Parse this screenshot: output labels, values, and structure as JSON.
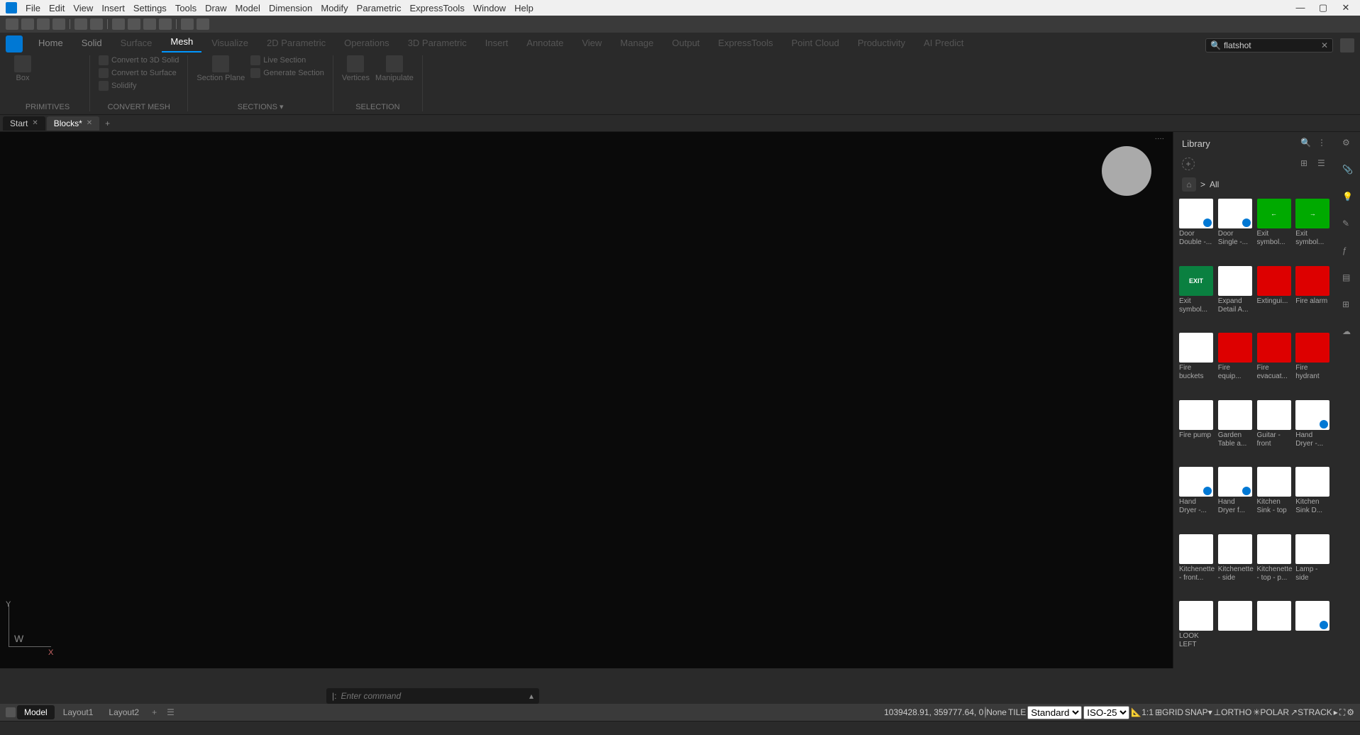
{
  "menubar": {
    "items": [
      "File",
      "Edit",
      "View",
      "Insert",
      "Settings",
      "Tools",
      "Draw",
      "Model",
      "Dimension",
      "Modify",
      "Parametric",
      "ExpressTools",
      "Window",
      "Help"
    ]
  },
  "ribbonTabs": {
    "items": [
      "Home",
      "Solid",
      "Surface",
      "Mesh",
      "Visualize",
      "2D Parametric",
      "Operations",
      "3D Parametric",
      "Insert",
      "Annotate",
      "View",
      "Manage",
      "Output",
      "ExpressTools",
      "Point Cloud",
      "Productivity",
      "AI Predict"
    ],
    "activeIndex": 3,
    "searchValue": "flatshot"
  },
  "ribbon": {
    "groups": [
      {
        "label": "PRIMITIVES",
        "tools": [
          "Box"
        ]
      },
      {
        "label": "CONVERT MESH",
        "list": [
          "Convert to 3D Solid",
          "Convert to Surface",
          "Solidify"
        ]
      },
      {
        "label": "SECTIONS",
        "tools": [
          "Section Plane"
        ],
        "list": [
          "Live Section",
          "Generate Section"
        ]
      },
      {
        "label": "SELECTION",
        "tools": [
          "Vertices",
          "Manipulate"
        ]
      }
    ]
  },
  "docTabs": {
    "items": [
      "Start",
      "Blocks*"
    ],
    "activeIndex": 1
  },
  "library": {
    "title": "Library",
    "path": "All",
    "items": [
      {
        "name": "Door Double -...",
        "style": "white",
        "badge": true
      },
      {
        "name": "Door Single -...",
        "style": "white",
        "badge": true
      },
      {
        "name": "Exit symbol...",
        "style": "green",
        "text": "←"
      },
      {
        "name": "Exit symbol...",
        "style": "green",
        "text": "→"
      },
      {
        "name": "Exit symbol...",
        "style": "green-exit",
        "text": "EXIT"
      },
      {
        "name": "Expand Detail A...",
        "style": "white"
      },
      {
        "name": "Extingui...",
        "style": "red"
      },
      {
        "name": "Fire alarm",
        "style": "red"
      },
      {
        "name": "Fire buckets",
        "style": "white"
      },
      {
        "name": "Fire equip...",
        "style": "red"
      },
      {
        "name": "Fire evacuat...",
        "style": "red"
      },
      {
        "name": "Fire hydrant",
        "style": "red"
      },
      {
        "name": "Fire pump",
        "style": "white"
      },
      {
        "name": "Garden Table a...",
        "style": "white"
      },
      {
        "name": "Guitar - front",
        "style": "white"
      },
      {
        "name": "Hand Dryer -...",
        "style": "white",
        "badge": true
      },
      {
        "name": "Hand Dryer -...",
        "style": "white",
        "badge": true
      },
      {
        "name": "Hand Dryer f...",
        "style": "white",
        "badge": true
      },
      {
        "name": "Kitchen Sink - top",
        "style": "white"
      },
      {
        "name": "Kitchen Sink D...",
        "style": "white"
      },
      {
        "name": "Kitchenette - front...",
        "style": "white"
      },
      {
        "name": "Kitchenette - side",
        "style": "white"
      },
      {
        "name": "Kitchenette - top - p...",
        "style": "white"
      },
      {
        "name": "Lamp - side",
        "style": "white"
      },
      {
        "name": "LOOK LEFT",
        "style": "white"
      },
      {
        "name": "",
        "style": "white"
      },
      {
        "name": "",
        "style": "white"
      },
      {
        "name": "",
        "style": "white",
        "badge": true
      }
    ]
  },
  "ucs": {
    "w": "W",
    "x": "X",
    "y": "Y"
  },
  "cmdline": {
    "prompt": "|:",
    "placeholder": "Enter command"
  },
  "bottomTabs": {
    "items": [
      "Model",
      "Layout1",
      "Layout2"
    ],
    "activeIndex": 0
  },
  "statusbar": {
    "coords": "1039428.91, 359777.64, 0",
    "none": "None",
    "tile": "TILE",
    "standard": "Standard",
    "iso": "ISO-25",
    "ratio": "1:1",
    "grid": "GRID",
    "snap": "SNAP",
    "ortho": "ORTHO",
    "polar": "POLAR",
    "strack": "STRACK"
  }
}
